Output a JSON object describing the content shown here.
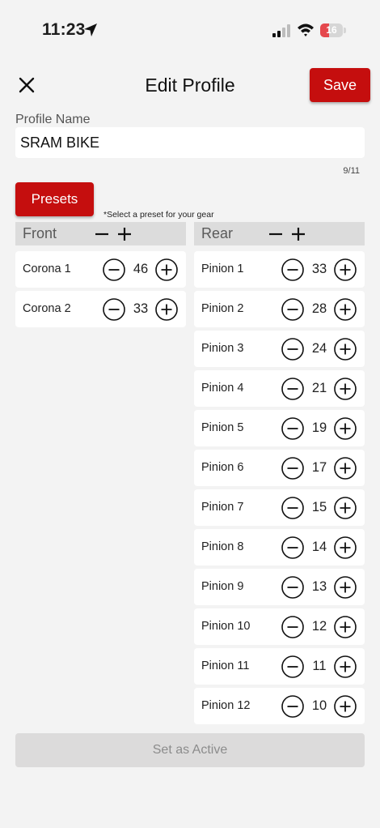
{
  "status": {
    "time": "11:23",
    "battery": "16",
    "battery_level": 0.16
  },
  "header": {
    "title": "Edit Profile",
    "save_label": "Save"
  },
  "profile": {
    "name_label": "Profile Name",
    "name_value": "SRAM BIKE",
    "char_count": "9/11"
  },
  "presets": {
    "button_label": "Presets",
    "hint": "*Select a preset for your gear"
  },
  "front": {
    "title": "Front",
    "items": [
      {
        "label": "Corona 1",
        "value": "46"
      },
      {
        "label": "Corona 2",
        "value": "33"
      }
    ]
  },
  "rear": {
    "title": "Rear",
    "items": [
      {
        "label": "Pinion 1",
        "value": "33"
      },
      {
        "label": "Pinion 2",
        "value": "28"
      },
      {
        "label": "Pinion 3",
        "value": "24"
      },
      {
        "label": "Pinion 4",
        "value": "21"
      },
      {
        "label": "Pinion 5",
        "value": "19"
      },
      {
        "label": "Pinion 6",
        "value": "17"
      },
      {
        "label": "Pinion 7",
        "value": "15"
      },
      {
        "label": "Pinion 8",
        "value": "14"
      },
      {
        "label": "Pinion 9",
        "value": "13"
      },
      {
        "label": "Pinion 10",
        "value": "12"
      },
      {
        "label": "Pinion 11",
        "value": "11"
      },
      {
        "label": "Pinion 12",
        "value": "10"
      }
    ]
  },
  "footer": {
    "set_active_label": "Set as Active"
  },
  "colors": {
    "accent": "#c50e0e",
    "background": "#f3f3f3",
    "header_bg": "#dcdcdc",
    "battery_low": "#e5484d"
  }
}
